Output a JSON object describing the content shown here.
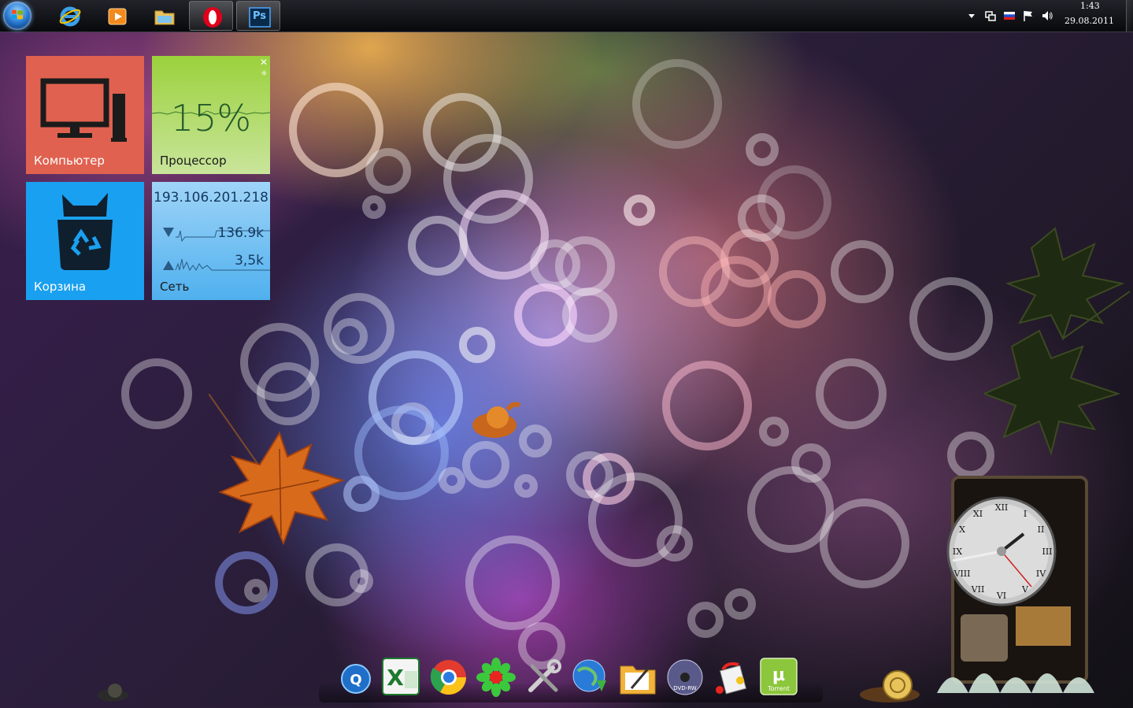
{
  "taskbar": {
    "start_label": "Start",
    "pinned": [
      {
        "name": "internet-explorer",
        "icon": "ie-icon"
      },
      {
        "name": "media-player",
        "icon": "media-player-icon"
      },
      {
        "name": "windows-explorer",
        "icon": "folder-icon"
      },
      {
        "name": "opera",
        "icon": "opera-icon",
        "active": true
      },
      {
        "name": "photoshop",
        "icon": "photoshop-icon",
        "label": "Ps",
        "active": true
      }
    ],
    "tray": {
      "icons": [
        "show-hidden-icons",
        "network-icon",
        "language-flag-ru",
        "action-center-flag",
        "volume-icon"
      ],
      "time": "1:43",
      "date": "29.08.2011"
    }
  },
  "tiles": {
    "computer": {
      "label": "Компьютер",
      "color": "#e0614f"
    },
    "cpu": {
      "label": "Процессор",
      "value": "15%",
      "color": "#9bd13c"
    },
    "recycle": {
      "label": "Корзина",
      "color": "#1aa0f0"
    },
    "network": {
      "label": "Сеть",
      "ip": "193.106.201.218",
      "download": "136.9k",
      "upload": "3,5k",
      "color": "#4fb0ee"
    }
  },
  "dock": {
    "items": [
      {
        "name": "qip",
        "icon": "qip-icon"
      },
      {
        "name": "excel",
        "icon": "excel-icon"
      },
      {
        "name": "chrome",
        "icon": "chrome-icon"
      },
      {
        "name": "icq",
        "icon": "flower-icon"
      },
      {
        "name": "tools",
        "icon": "tools-icon"
      },
      {
        "name": "downloader",
        "icon": "globe-download-icon"
      },
      {
        "name": "notes",
        "icon": "folder-pencil-icon"
      },
      {
        "name": "dvd-burner",
        "icon": "dvd-icon",
        "label": "DVD-RW"
      },
      {
        "name": "paint",
        "icon": "paint-bucket-icon"
      },
      {
        "name": "utorrent",
        "icon": "utorrent-icon",
        "label": "Torrent"
      }
    ]
  },
  "clock_gadget": {
    "numerals": [
      "XII",
      "I",
      "II",
      "III",
      "IV",
      "V",
      "VI",
      "VII",
      "VIII",
      "IX",
      "X",
      "XI"
    ]
  }
}
